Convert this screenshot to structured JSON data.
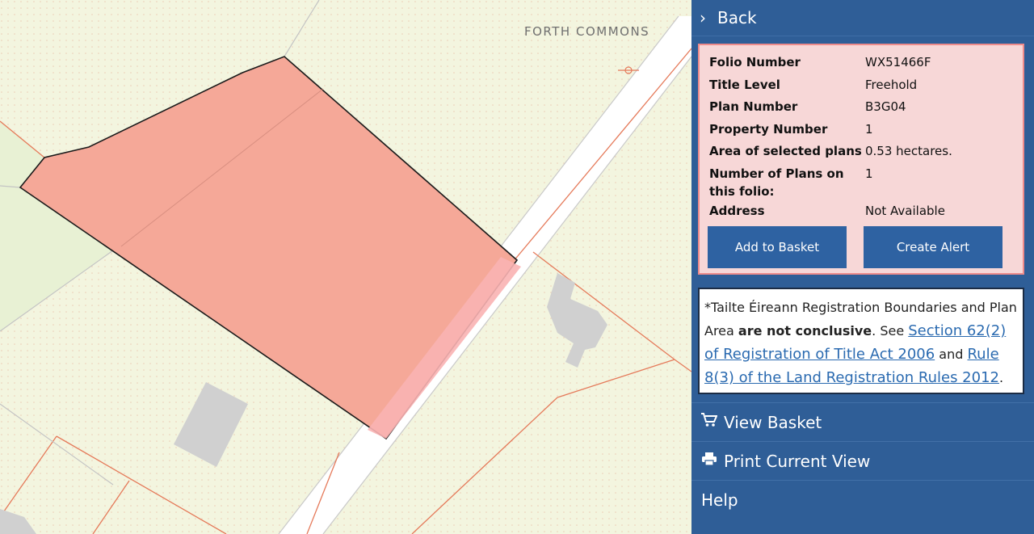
{
  "map": {
    "place_label": "FORTH COMMONS"
  },
  "panel": {
    "back_label": "Back",
    "details": [
      {
        "label": "Folio Number",
        "value": "WX51466F"
      },
      {
        "label": "Title Level",
        "value": "Freehold"
      },
      {
        "label": "Plan Number",
        "value": "B3G04"
      },
      {
        "label": "Property Number",
        "value": "1"
      },
      {
        "label": "Area of selected plans",
        "value": "0.53 hectares."
      },
      {
        "label": "Number of Plans on this folio:",
        "value": "1"
      },
      {
        "label": "Address",
        "value": "Not Available"
      }
    ],
    "buttons": {
      "add_to_basket": "Add to Basket",
      "create_alert": "Create Alert"
    },
    "disclaimer": {
      "intro": "*Tailte Éireann Registration Boundaries and Plan Area ",
      "bold": "are not conclusive",
      "see": ". See ",
      "link1": "Section 62(2) of Registration of Title Act 2006",
      "and": " and ",
      "link2": "Rule 8(3) of the Land Registration Rules 2012",
      "end": "."
    },
    "menu": {
      "view_basket": "View Basket",
      "print_view": "Print Current View",
      "help": "Help"
    }
  },
  "colors": {
    "panel_bg": "#2f5e97",
    "button_bg": "#2e62a2",
    "highlight_fill": "#f5a898",
    "info_box_bg": "#f7d7d7",
    "link": "#2a6ab0"
  }
}
